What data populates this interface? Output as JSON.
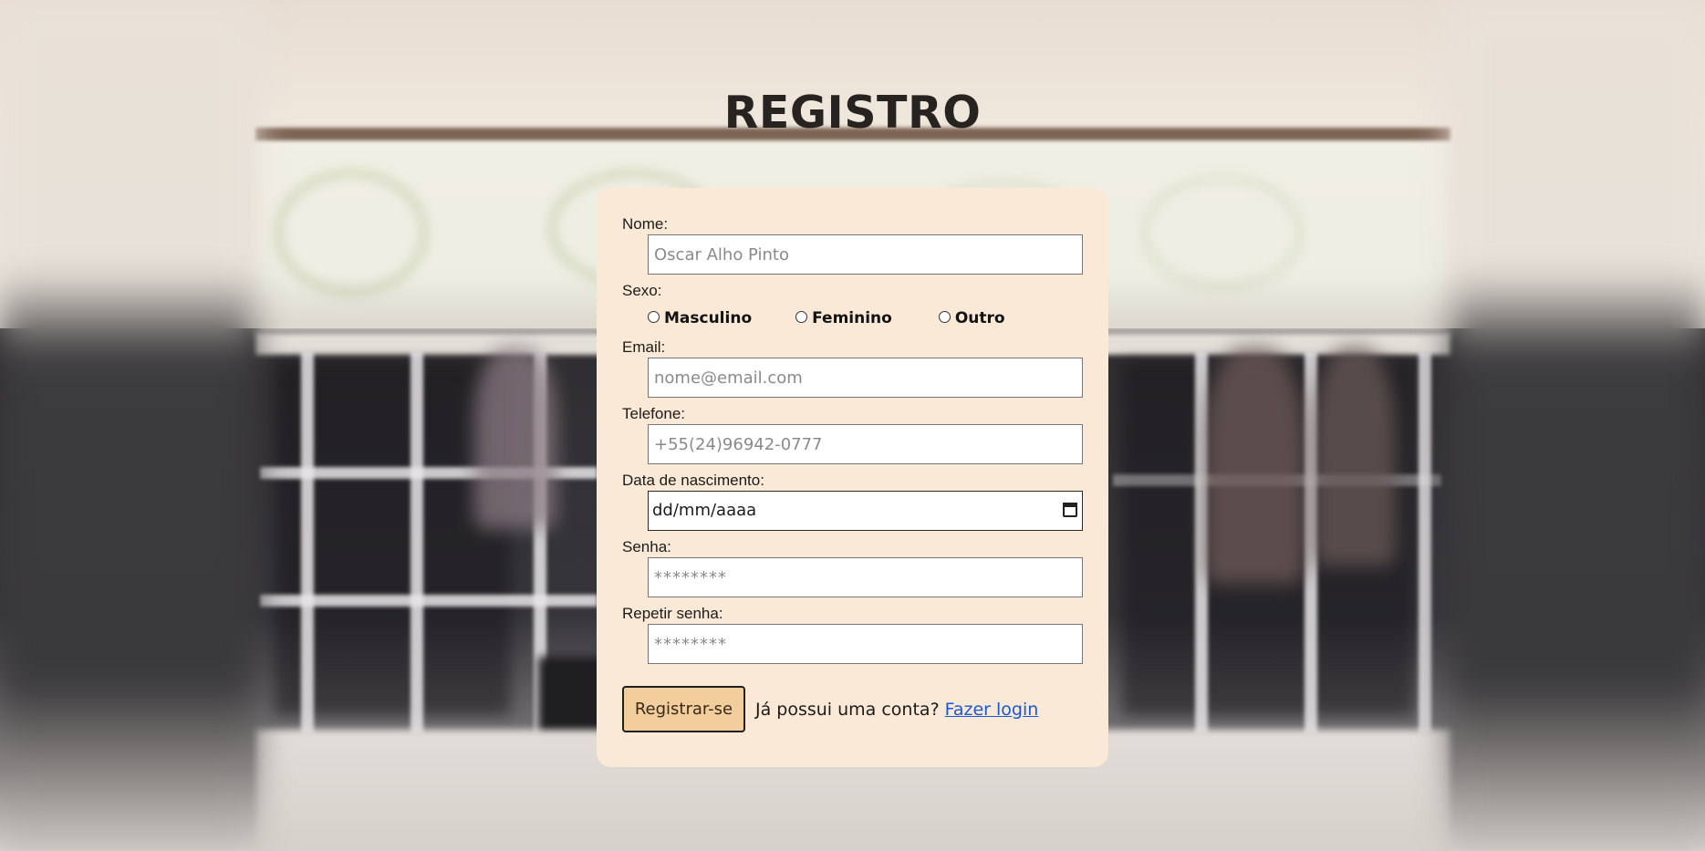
{
  "page": {
    "title": "REGISTRO"
  },
  "form": {
    "nome": {
      "label": "Nome:",
      "placeholder": "Oscar Alho Pinto"
    },
    "sexo": {
      "label": "Sexo:",
      "options": [
        "Masculino",
        "Feminino",
        "Outro"
      ]
    },
    "email": {
      "label": "Email:",
      "placeholder": "nome@email.com"
    },
    "telefone": {
      "label": "Telefone:",
      "placeholder": "+55(24)96942-0777"
    },
    "nascimento": {
      "label": "Data de nascimento:",
      "value": "dd/mm/aaaa"
    },
    "senha": {
      "label": "Senha:",
      "placeholder": "********"
    },
    "repetir_senha": {
      "label": "Repetir senha:",
      "placeholder": "********"
    }
  },
  "actions": {
    "register_label": "Registrar-se",
    "login_prompt": "Já possui uma conta?",
    "login_link": "Fazer login"
  },
  "colors": {
    "card_bg": "#fae9d6",
    "button_bg": "#f2ce9c",
    "link": "#1a57d6",
    "title": "#262321"
  }
}
